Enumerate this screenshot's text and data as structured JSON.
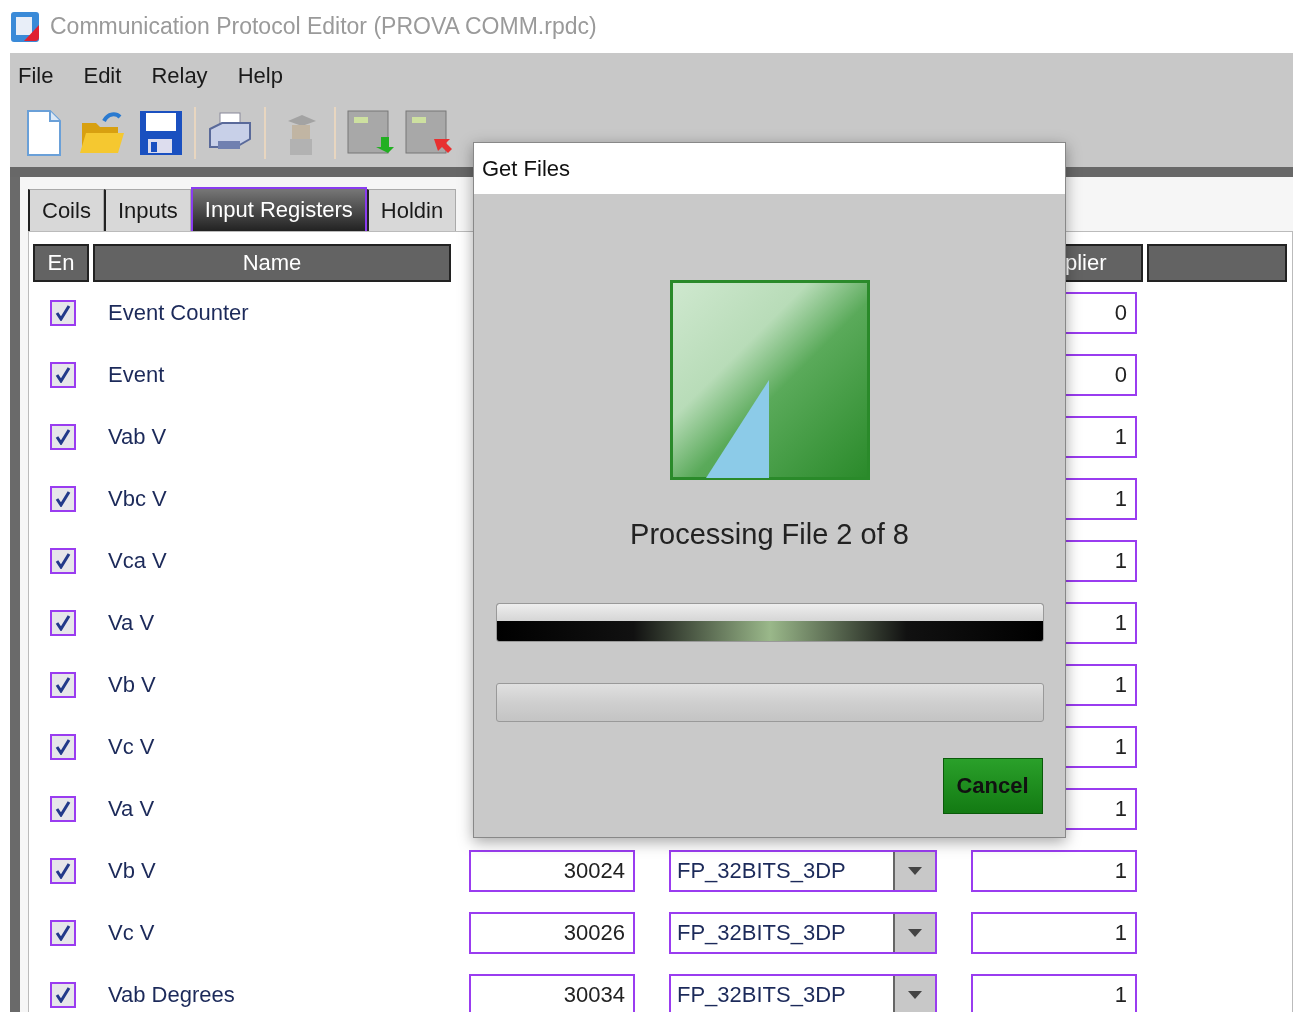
{
  "window": {
    "title": "Communication Protocol Editor (PROVA COMM.rpdc)"
  },
  "menu": [
    "File",
    "Edit",
    "Relay",
    "Help"
  ],
  "toolbar": [
    {
      "kind": "new",
      "disabled": false
    },
    {
      "kind": "open",
      "disabled": false
    },
    {
      "kind": "save",
      "disabled": false
    },
    {
      "kind": "separator"
    },
    {
      "kind": "print",
      "disabled": false
    },
    {
      "kind": "separator"
    },
    {
      "kind": "figure",
      "disabled": true
    },
    {
      "kind": "separator"
    },
    {
      "kind": "download",
      "disabled": false
    },
    {
      "kind": "upload",
      "disabled": false
    }
  ],
  "tabs": [
    {
      "label": "Coils",
      "selected": false
    },
    {
      "label": "Inputs",
      "selected": false
    },
    {
      "label": "Input Registers",
      "selected": true
    },
    {
      "label": "Holdin",
      "selected": false
    }
  ],
  "table": {
    "columns": [
      {
        "kind": "en",
        "label": "En"
      },
      {
        "kind": "name",
        "label": "Name"
      },
      {
        "kind": "multiplier",
        "label": "plier"
      }
    ],
    "rows": [
      {
        "enabled": true,
        "name": "Event Counter",
        "multiplier": "0"
      },
      {
        "enabled": true,
        "name": "Event",
        "multiplier": "0"
      },
      {
        "enabled": true,
        "name": "Vab V",
        "multiplier": "1"
      },
      {
        "enabled": true,
        "name": "Vbc V",
        "multiplier": "1"
      },
      {
        "enabled": true,
        "name": "Vca V",
        "multiplier": "1"
      },
      {
        "enabled": true,
        "name": "Va V",
        "multiplier": "1"
      },
      {
        "enabled": true,
        "name": "Vb V",
        "multiplier": "1"
      },
      {
        "enabled": true,
        "name": "Vc V",
        "multiplier": "1"
      },
      {
        "enabled": true,
        "name": "Va V",
        "multiplier": "1"
      },
      {
        "enabled": true,
        "name": "Vb V",
        "address": "30024",
        "type": "FP_32BITS_3DP",
        "multiplier": "1"
      },
      {
        "enabled": true,
        "name": "Vc V",
        "address": "30026",
        "type": "FP_32BITS_3DP",
        "multiplier": "1"
      },
      {
        "enabled": true,
        "name": "Vab Degrees",
        "address": "30034",
        "type": "FP_32BITS_3DP",
        "multiplier": "1"
      }
    ]
  },
  "dialog": {
    "title": "Get Files",
    "message": "Processing File 2 of 8",
    "bars": [
      {
        "kind": "marquee",
        "busy": true
      },
      {
        "kind": "determinate",
        "level": 0
      }
    ],
    "buttons": [
      "Cancel"
    ]
  }
}
